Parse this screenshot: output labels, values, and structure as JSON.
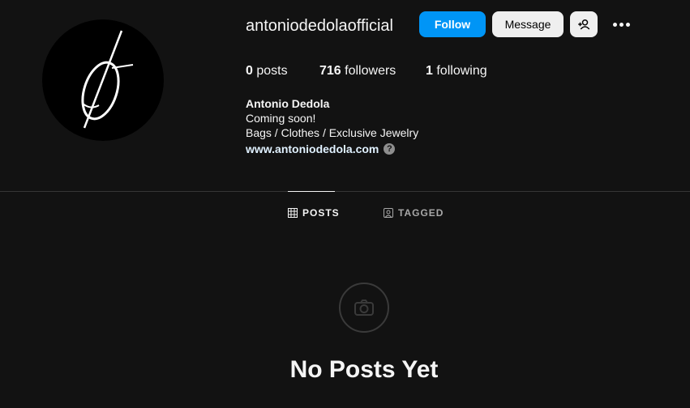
{
  "profile": {
    "username": "antoniodedolaofficial",
    "follow_label": "Follow",
    "message_label": "Message",
    "suggest_icon": "add-user-icon",
    "more_icon": "more-icon"
  },
  "stats": {
    "posts_count": "0",
    "posts_label": "posts",
    "followers_count": "716",
    "followers_label": "followers",
    "following_count": "1",
    "following_label": "following"
  },
  "bio": {
    "name": "Antonio Dedola",
    "line1": "Coming soon!",
    "line2": "Bags / Clothes / Exclusive Jewelry",
    "link": "www.antoniodedola.com"
  },
  "tabs": [
    {
      "label": "POSTS",
      "icon": "grid-icon",
      "active": true
    },
    {
      "label": "TAGGED",
      "icon": "tagged-icon",
      "active": false
    }
  ],
  "empty_state": {
    "icon": "camera-icon",
    "title": "No Posts Yet"
  },
  "colors": {
    "background": "#121212",
    "follow_button": "#0095f6",
    "secondary_button": "#efefef"
  }
}
